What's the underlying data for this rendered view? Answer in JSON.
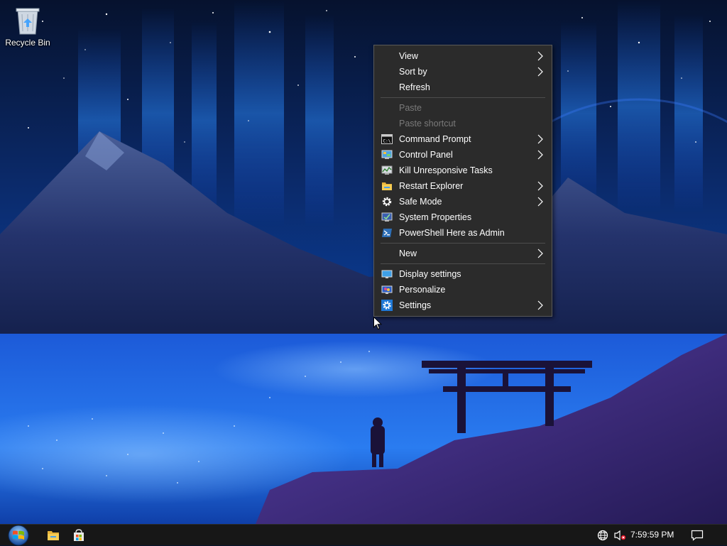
{
  "desktop": {
    "recycle_bin_label": "Recycle Bin"
  },
  "context_menu": {
    "items": [
      {
        "label": "View",
        "icon": "none",
        "submenu": true,
        "enabled": true
      },
      {
        "label": "Sort by",
        "icon": "none",
        "submenu": true,
        "enabled": true
      },
      {
        "label": "Refresh",
        "icon": "none",
        "submenu": false,
        "enabled": true
      },
      {
        "label": "Paste",
        "icon": "none",
        "submenu": false,
        "enabled": false
      },
      {
        "label": "Paste shortcut",
        "icon": "none",
        "submenu": false,
        "enabled": false
      },
      {
        "label": "Command Prompt",
        "icon": "command-prompt-icon",
        "submenu": true,
        "enabled": true
      },
      {
        "label": "Control Panel",
        "icon": "control-panel-icon",
        "submenu": true,
        "enabled": true
      },
      {
        "label": "Kill Unresponsive Tasks",
        "icon": "task-manager-icon",
        "submenu": false,
        "enabled": true
      },
      {
        "label": "Restart Explorer",
        "icon": "folder-icon",
        "submenu": true,
        "enabled": true
      },
      {
        "label": "Safe Mode",
        "icon": "gear-icon",
        "submenu": true,
        "enabled": true
      },
      {
        "label": "System Properties",
        "icon": "system-properties-icon",
        "submenu": false,
        "enabled": true
      },
      {
        "label": "PowerShell Here as Admin",
        "icon": "powershell-icon",
        "submenu": false,
        "enabled": true
      },
      {
        "label": "New",
        "icon": "none",
        "submenu": true,
        "enabled": true
      },
      {
        "label": "Display settings",
        "icon": "display-icon",
        "submenu": false,
        "enabled": true
      },
      {
        "label": "Personalize",
        "icon": "personalize-icon",
        "submenu": false,
        "enabled": true
      },
      {
        "label": "Settings",
        "icon": "settings-gear-icon",
        "submenu": true,
        "enabled": true
      }
    ]
  },
  "taskbar": {
    "clock": "7:59:59 PM",
    "pinned": [
      "file-explorer-icon",
      "store-icon"
    ],
    "tray": [
      "network-globe-icon",
      "volume-muted-icon",
      "notification-icon"
    ]
  },
  "colors": {
    "menu_bg": "#2b2b2b",
    "menu_border": "#5a5a5a",
    "disabled_text": "#7a7a7a",
    "taskbar_bg": "#171717"
  }
}
